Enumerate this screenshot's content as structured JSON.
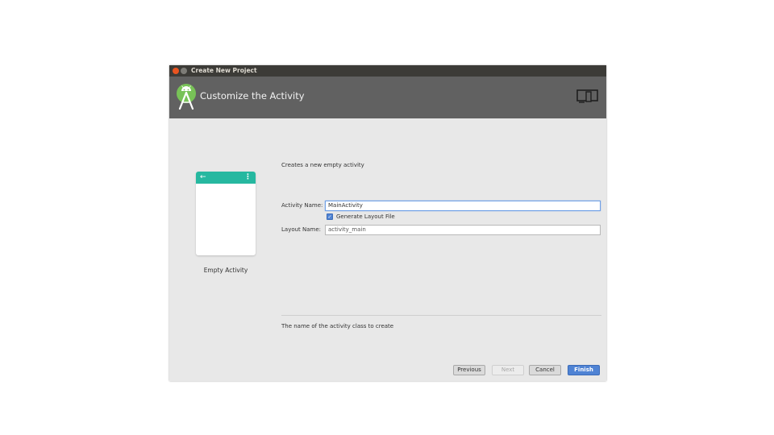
{
  "window": {
    "title": "Create New Project"
  },
  "header": {
    "title": "Customize the Activity"
  },
  "template": {
    "name": "Empty Activity"
  },
  "form": {
    "description": "Creates a new empty activity",
    "activity_name_label": "Activity Name:",
    "activity_name_value": "MainActivity",
    "generate_layout_label": "Generate Layout File",
    "generate_layout_checked": true,
    "layout_name_label": "Layout Name:",
    "layout_name_value": "activity_main"
  },
  "help_text": "The name of the activity class to create",
  "buttons": {
    "previous": "Previous",
    "next": "Next",
    "cancel": "Cancel",
    "finish": "Finish"
  },
  "colors": {
    "banner": "#616161",
    "preview_toolbar": "#26b8a0",
    "primary_button": "#4f83d4",
    "android_green": "#78c257"
  },
  "icons": {
    "logo": "android-studio-logo-icon",
    "device": "phone-tablet-icon",
    "back": "arrow-left-icon",
    "menu": "overflow-menu-icon"
  }
}
